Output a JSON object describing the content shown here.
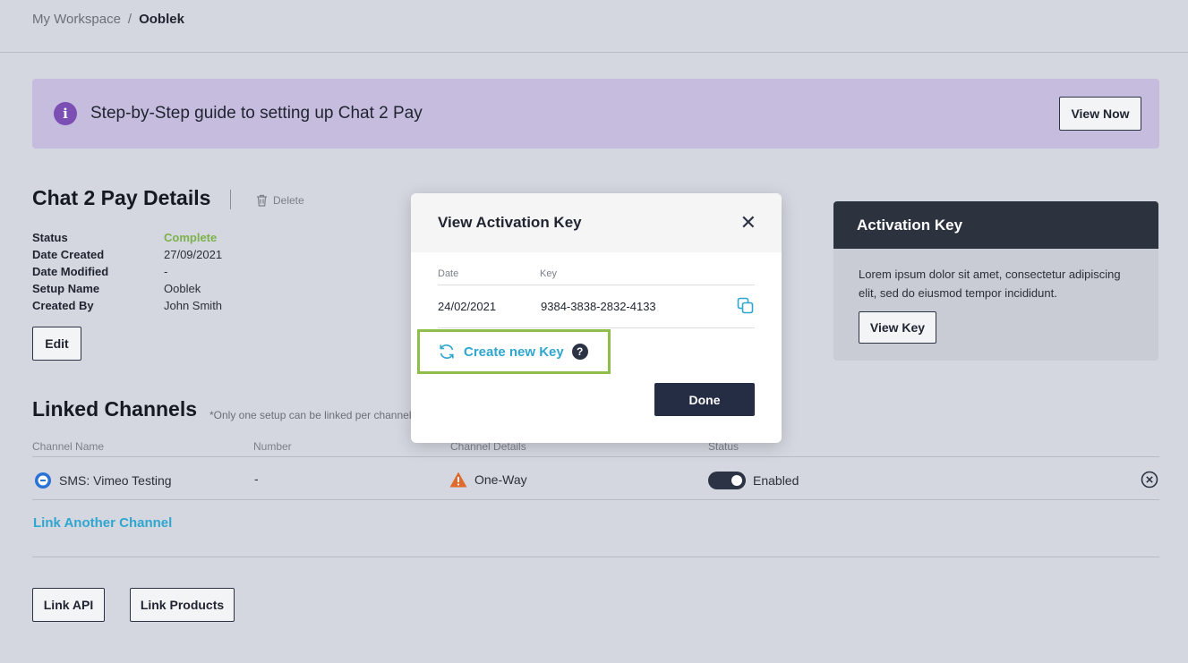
{
  "breadcrumb": {
    "root": "My Workspace",
    "separator": "/",
    "current": "Ooblek"
  },
  "banner": {
    "text": "Step-by-Step guide to setting up Chat 2 Pay",
    "button_label": "View Now",
    "info_glyph": "i"
  },
  "details": {
    "title": "Chat 2 Pay Details",
    "delete_label": "Delete",
    "rows": [
      {
        "key": "Status",
        "value": "Complete"
      },
      {
        "key": "Date Created",
        "value": "27/09/2021"
      },
      {
        "key": "Date Modified",
        "value": "-"
      },
      {
        "key": "Setup Name",
        "value": "Ooblek"
      },
      {
        "key": "Created By",
        "value": "John Smith"
      }
    ],
    "edit_label": "Edit"
  },
  "linked": {
    "title": "Linked Channels",
    "note": "*Only one setup can be linked per channel",
    "headers": [
      "Channel Name",
      "Number",
      "Channel Details",
      "Status"
    ],
    "row": {
      "name": "SMS: Vimeo Testing",
      "number": "-",
      "details": "One-Way",
      "status": "Enabled"
    },
    "link_another": "Link Another Channel"
  },
  "actions": {
    "link_api": "Link API",
    "link_products": "Link Products"
  },
  "activation_card": {
    "title": "Activation Key",
    "body": "Lorem ipsum dolor sit amet, consectetur adipiscing elit, sed do eiusmod tempor incididunt.",
    "button_label": "View Key"
  },
  "modal": {
    "title": "View Activation Key",
    "close_glyph": "✕",
    "headers": {
      "date": "Date",
      "key": "Key"
    },
    "row": {
      "date": "24/02/2021",
      "key": "9384-3838-2832-4133"
    },
    "create_label": "Create new Key",
    "help_glyph": "?",
    "done_label": "Done"
  },
  "colors": {
    "accent_link": "#2fa6cf",
    "complete": "#7cb24b",
    "highlight": "#8dbf4a",
    "primary": "#252d45",
    "info": "#7c4fb5",
    "warning": "#e06a2c"
  }
}
